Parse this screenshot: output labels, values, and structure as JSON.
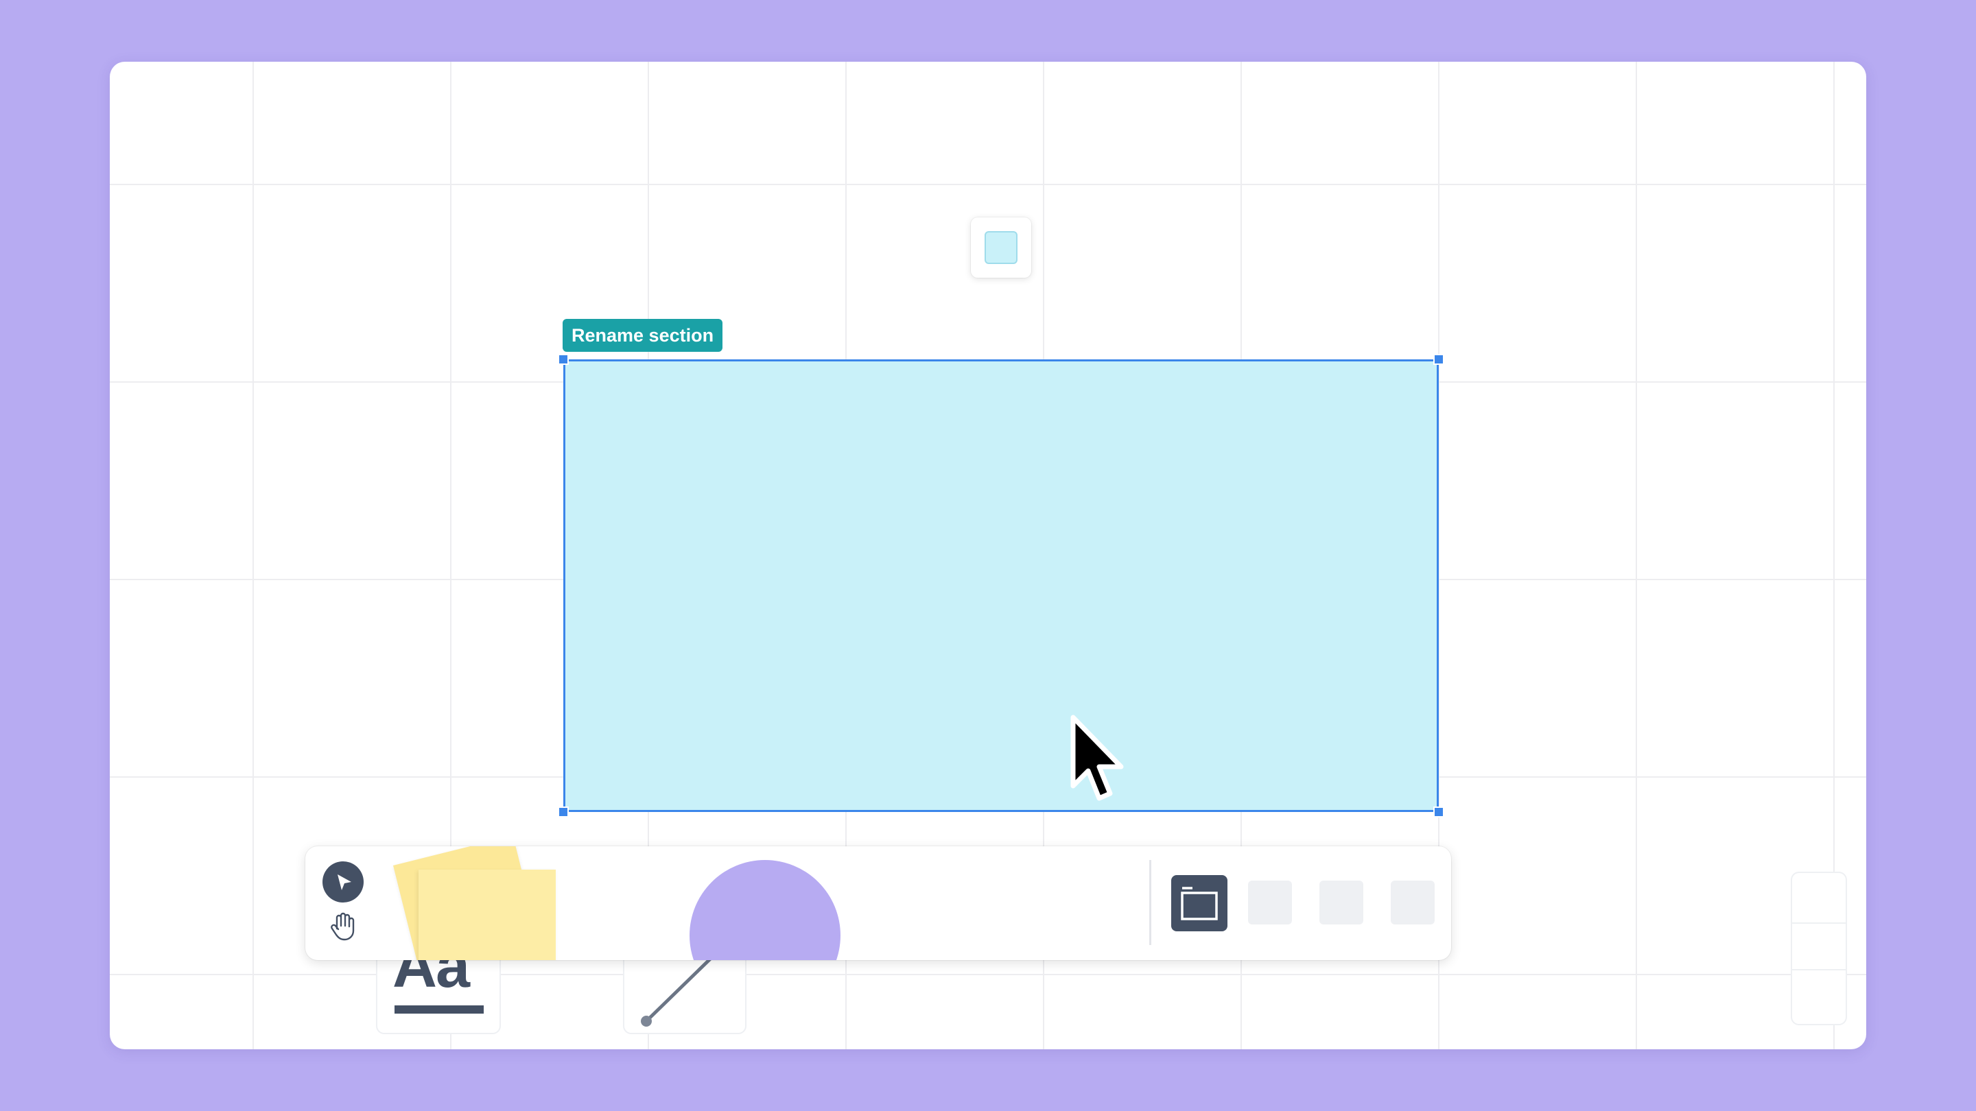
{
  "section": {
    "label": "Rename section",
    "fill_color": "#c9f1f9",
    "border_color": "#3b86ea"
  },
  "color_picker": {
    "selected_color": "#c9f1f9"
  },
  "toolbar": {
    "tools": [
      {
        "name": "select",
        "icon": "cursor-arrow-icon",
        "active": true
      },
      {
        "name": "pan",
        "icon": "hand-icon"
      },
      {
        "name": "sticky-note",
        "icon": "sticky-note-icon",
        "color": "#fdeda6"
      },
      {
        "name": "text",
        "icon": "text-icon",
        "label": "Aa"
      },
      {
        "name": "shape",
        "icon": "circle-shape-icon",
        "color": "#b7abf2"
      },
      {
        "name": "connector",
        "icon": "line-icon"
      },
      {
        "name": "section",
        "icon": "frame-icon",
        "active": true
      }
    ]
  },
  "colors": {
    "background": "#b7abf2",
    "canvas": "#ffffff",
    "label_bg": "#1aa1a6",
    "tool_dark": "#445064"
  }
}
